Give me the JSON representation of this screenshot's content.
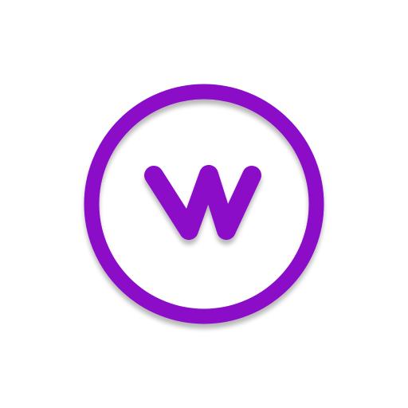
{
  "icon": {
    "name": "letter-w-circle-icon",
    "shape": "circle-outline-with-letter-w",
    "color": "#8B0CC8",
    "background": "#FFFFFF"
  }
}
